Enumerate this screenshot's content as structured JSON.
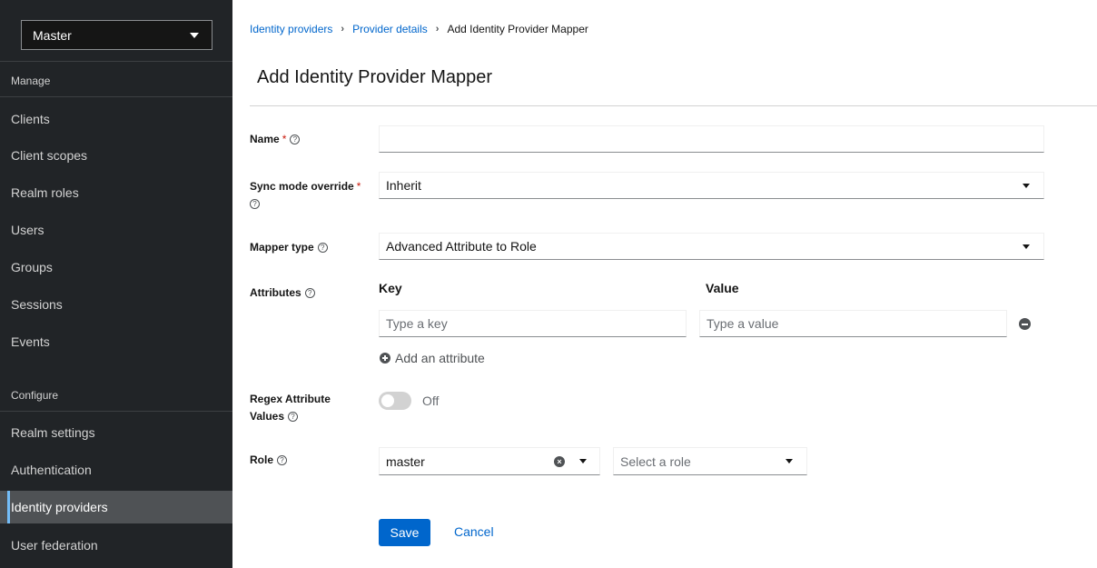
{
  "sidebar": {
    "realm": "Master",
    "sections": {
      "manage": "Manage",
      "configure": "Configure"
    },
    "items": [
      {
        "label": "Clients"
      },
      {
        "label": "Client scopes"
      },
      {
        "label": "Realm roles"
      },
      {
        "label": "Users"
      },
      {
        "label": "Groups"
      },
      {
        "label": "Sessions"
      },
      {
        "label": "Events"
      },
      {
        "label": "Realm settings"
      },
      {
        "label": "Authentication"
      },
      {
        "label": "Identity providers",
        "active": true
      },
      {
        "label": "User federation"
      }
    ]
  },
  "breadcrumb": {
    "items": [
      "Identity providers",
      "Provider details"
    ],
    "current": "Add Identity Provider Mapper"
  },
  "page": {
    "title": "Add Identity Provider Mapper"
  },
  "form": {
    "name": {
      "label": "Name",
      "value": ""
    },
    "sync_mode": {
      "label": "Sync mode override",
      "value": "Inherit"
    },
    "mapper_type": {
      "label": "Mapper type",
      "value": "Advanced Attribute to Role"
    },
    "attributes": {
      "label": "Attributes",
      "key_header": "Key",
      "value_header": "Value",
      "key_placeholder": "Type a key",
      "value_placeholder": "Type a value",
      "add_label": "Add an attribute"
    },
    "regex": {
      "label_line1": "Regex Attribute",
      "label_line2": "Values",
      "state": "Off"
    },
    "role": {
      "label": "Role",
      "client_value": "master",
      "role_placeholder": "Select a role"
    },
    "required_marker": "*",
    "help_glyph": "?",
    "clear_glyph": "×"
  },
  "actions": {
    "save": "Save",
    "cancel": "Cancel"
  },
  "colors": {
    "sidebar_bg": "#212427",
    "primary": "#0066cc",
    "active_indicator": "#73bcf7"
  }
}
